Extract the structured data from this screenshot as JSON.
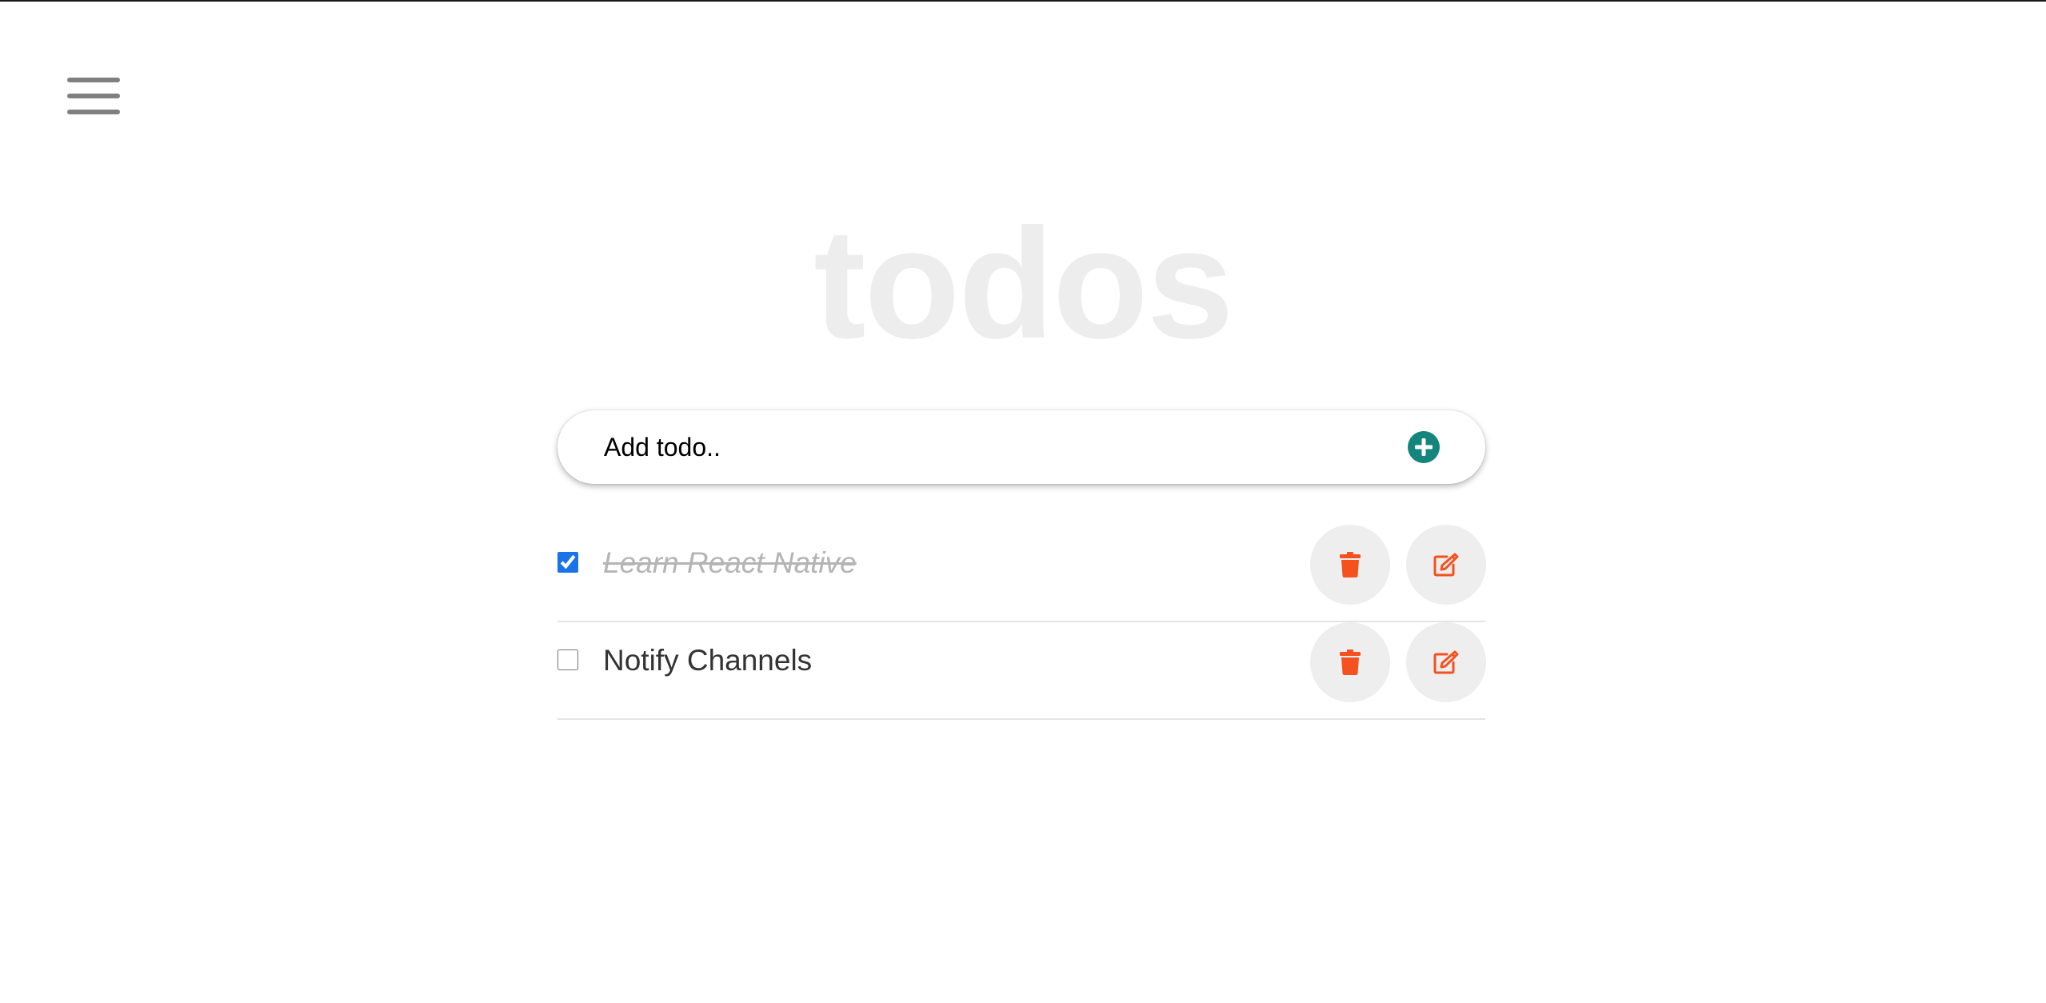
{
  "header": {
    "menu_icon": "hamburger-menu-icon",
    "title": "todos"
  },
  "add_todo": {
    "placeholder": "Add todo..",
    "value": "",
    "add_icon": "plus-circle-icon"
  },
  "todos": [
    {
      "text": "Learn React Native",
      "completed": true,
      "delete_icon": "trash-icon",
      "edit_icon": "edit-icon"
    },
    {
      "text": "Notify Channels",
      "completed": false,
      "delete_icon": "trash-icon",
      "edit_icon": "edit-icon"
    }
  ],
  "colors": {
    "title": "#ededed",
    "add_button": "#13857d",
    "action_icon": "#f4511e",
    "action_button_bg": "#eeeeee",
    "checkbox_checked": "#1a73e8",
    "completed_text": "#b5b5b5",
    "text": "#333333",
    "menu_icon": "#808080"
  }
}
